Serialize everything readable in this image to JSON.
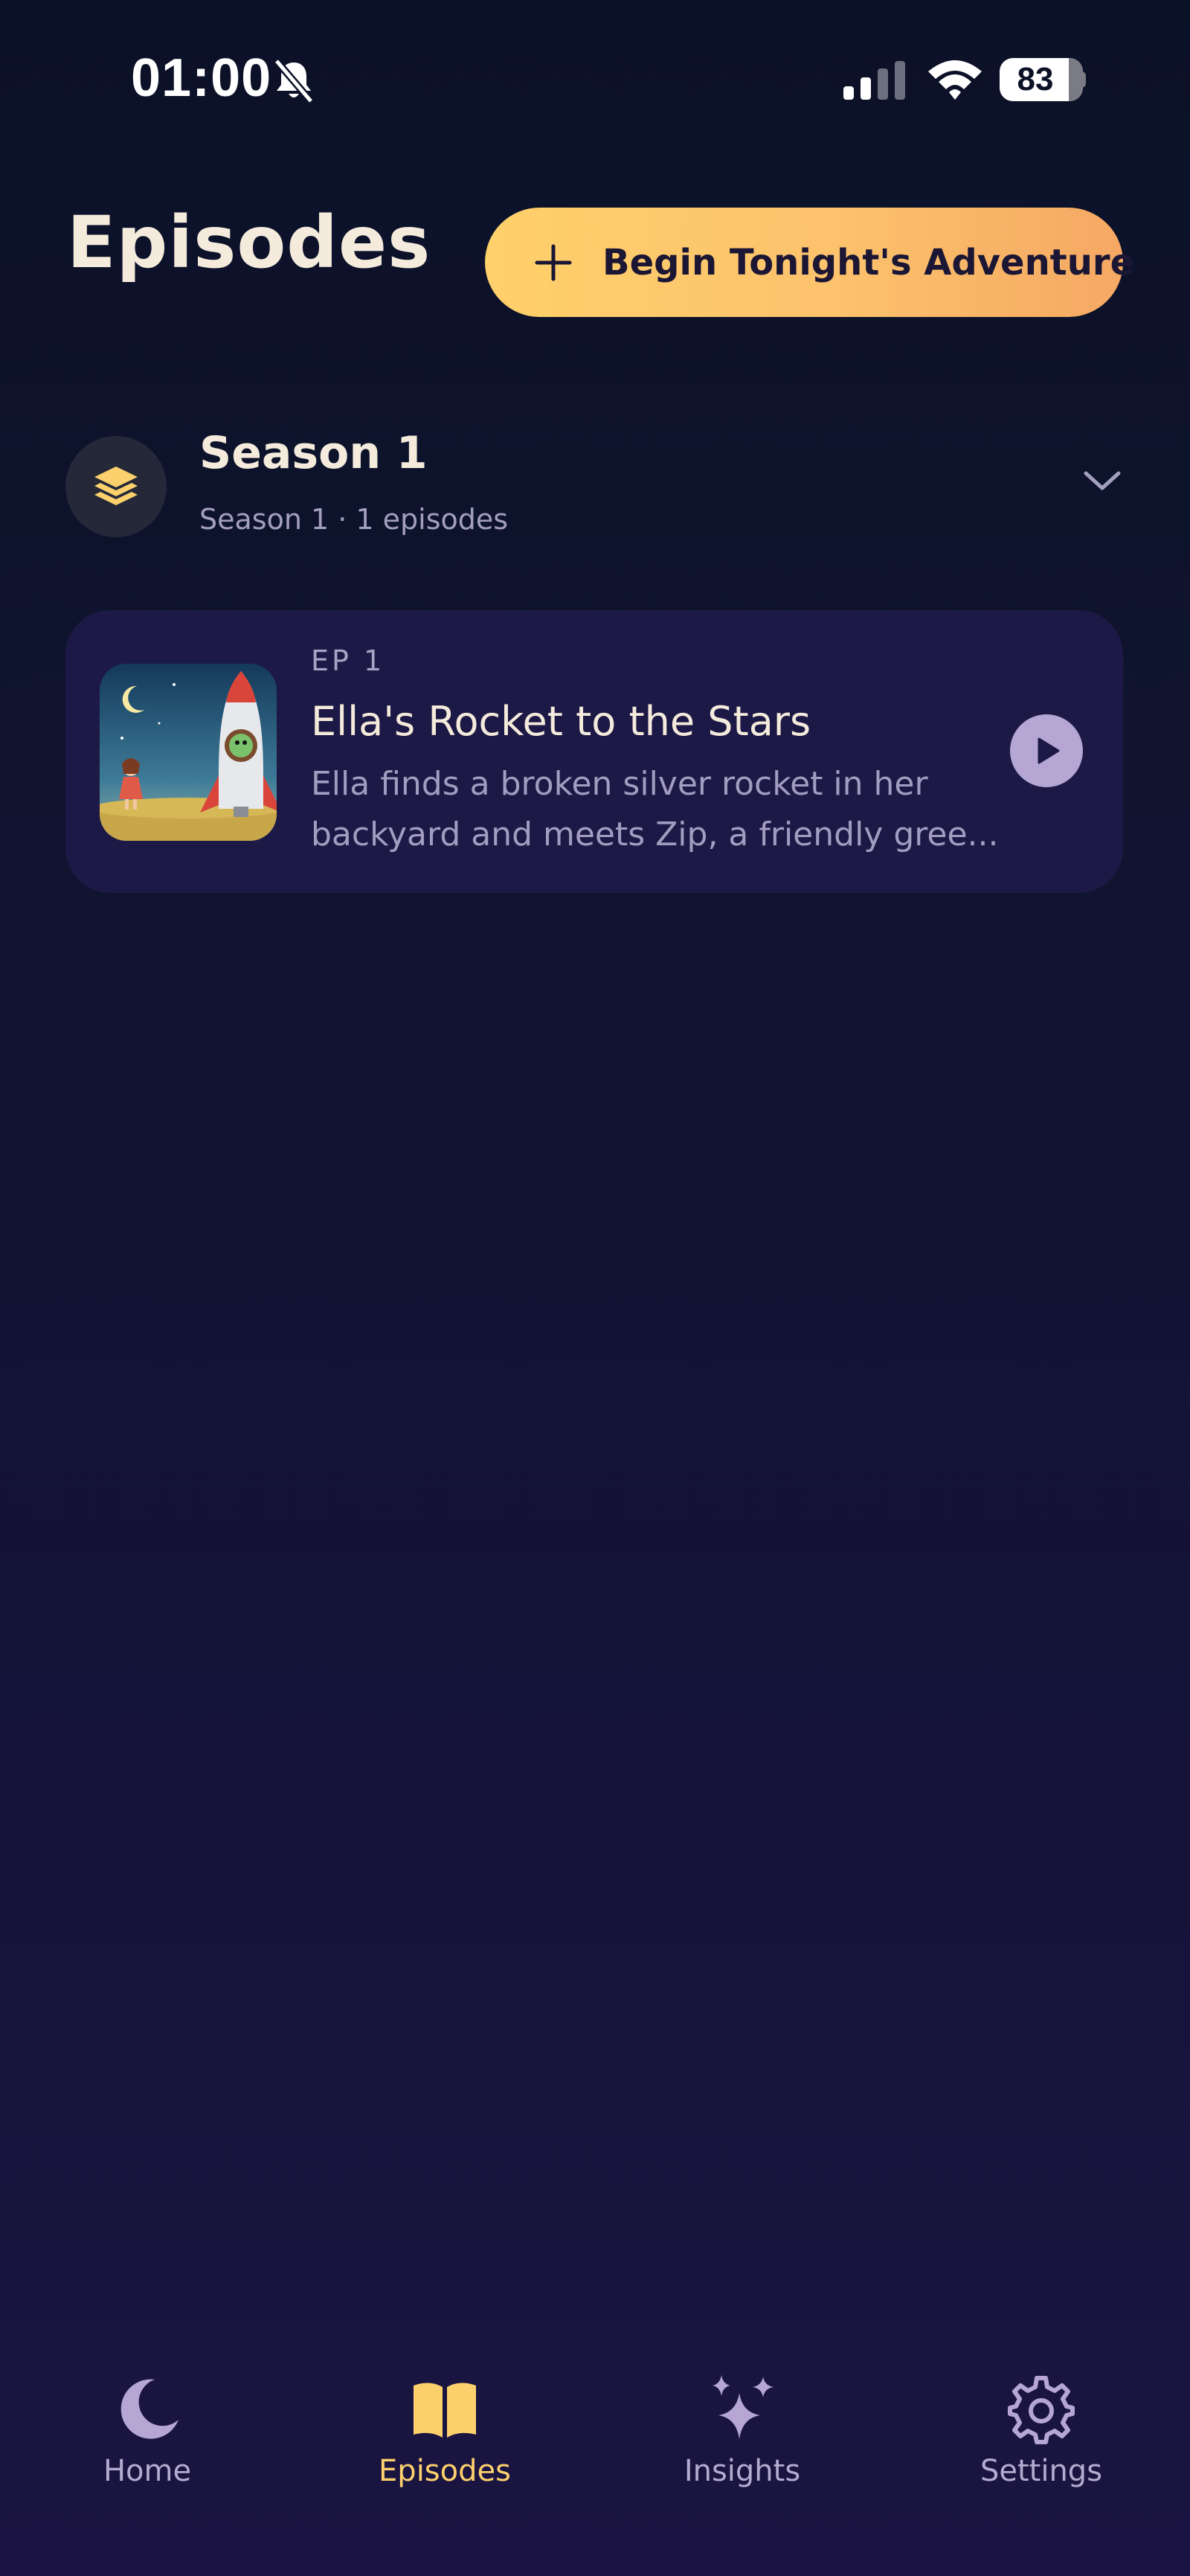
{
  "status_bar": {
    "time": "01:00",
    "battery_level": "83",
    "battery_fraction": 0.83
  },
  "header": {
    "title": "Episodes",
    "adventure_button_label": "Begin Tonight's Adventure"
  },
  "season": {
    "title": "Season 1",
    "subtitle": "Season 1 · 1 episodes"
  },
  "episodes": [
    {
      "number": "EP 1",
      "title": "Ella's Rocket to the Stars",
      "description_line1": "Ella finds a broken silver rocket in her",
      "description_line2": "backyard and meets Zip, a friendly gree..."
    }
  ],
  "tabs": [
    {
      "label": "Home",
      "icon": "moon-icon",
      "active": false
    },
    {
      "label": "Episodes",
      "icon": "book-icon",
      "active": true
    },
    {
      "label": "Insights",
      "icon": "sparkles-icon",
      "active": false
    },
    {
      "label": "Settings",
      "icon": "gear-icon",
      "active": false
    }
  ],
  "colors": {
    "accent": "#fbd06d",
    "button_gradient_end": "#f5a863",
    "card_background": "#1d1946",
    "muted_text": "#a29dc0",
    "inactive_tab": "#b2acd0"
  }
}
